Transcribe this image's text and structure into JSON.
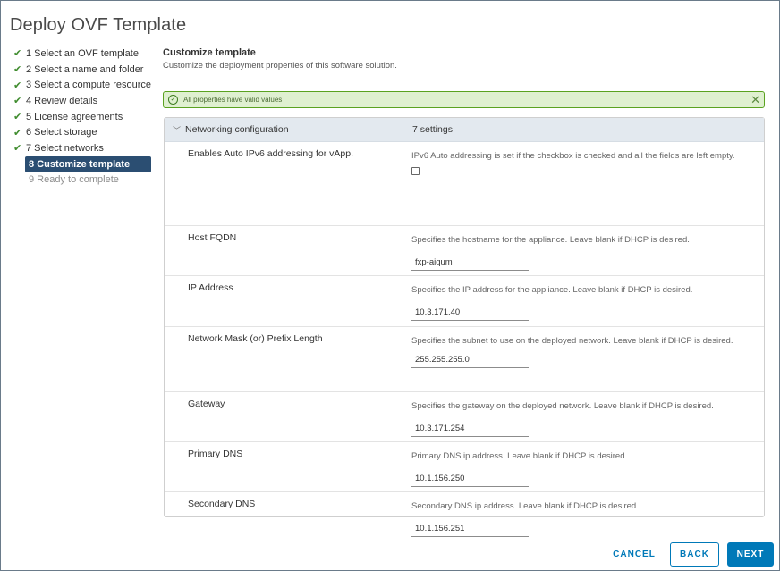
{
  "window": {
    "title": "Deploy OVF Template"
  },
  "steps": [
    {
      "label": "1 Select an OVF template",
      "state": "done"
    },
    {
      "label": "2 Select a name and folder",
      "state": "done"
    },
    {
      "label": "3 Select a compute resource",
      "state": "done"
    },
    {
      "label": "4 Review details",
      "state": "done"
    },
    {
      "label": "5 License agreements",
      "state": "done"
    },
    {
      "label": "6 Select storage",
      "state": "done"
    },
    {
      "label": "7 Select networks",
      "state": "done"
    },
    {
      "label": "8 Customize template",
      "state": "active"
    },
    {
      "label": "9 Ready to complete",
      "state": "pending"
    }
  ],
  "main": {
    "title": "Customize template",
    "subtitle": "Customize the deployment properties of this software solution."
  },
  "alert": {
    "text": "All properties have valid values",
    "color": "#5aa220"
  },
  "table": {
    "group_label": "Networking configuration",
    "group_count": "7 settings",
    "rows": [
      {
        "label": "Enables Auto IPv6 addressing for vApp.",
        "description": "IPv6 Auto addressing is set if the checkbox is checked and all the fields are left empty.",
        "type": "checkbox",
        "checked": false
      },
      {
        "label": "Host FQDN",
        "description": "Specifies the hostname for the appliance. Leave blank if DHCP is desired.",
        "type": "text",
        "value": "fxp-aiqum"
      },
      {
        "label": "IP Address",
        "description": "Specifies the IP address for the appliance. Leave blank if DHCP is desired.",
        "type": "text",
        "value": "10.3.171.40"
      },
      {
        "label": "Network Mask (or) Prefix Length",
        "description": "Specifies the subnet to use on the deployed network. Leave blank if DHCP is desired.",
        "type": "text",
        "value": "255.255.255.0"
      },
      {
        "label": "Gateway",
        "description": "Specifies the gateway on the deployed network. Leave blank if DHCP is desired.",
        "type": "text",
        "value": "10.3.171.254"
      },
      {
        "label": "Primary DNS",
        "description": "Primary DNS ip address. Leave blank if DHCP is desired.",
        "type": "text",
        "value": "10.1.156.250"
      },
      {
        "label": "Secondary DNS",
        "description": "Secondary DNS ip address. Leave blank if DHCP is desired.",
        "type": "text",
        "value": "10.1.156.251"
      }
    ]
  },
  "footer": {
    "cancel": "CANCEL",
    "back": "BACK",
    "next": "NEXT"
  },
  "colors": {
    "accent": "#0079b8",
    "active_step": "#2b4e72",
    "check": "#3f8c2e",
    "header_bg": "#e3e9ef"
  },
  "icons": {
    "step_done": "check-icon",
    "alert_ok": "check-circle-icon",
    "alert_close": "close-icon",
    "group_toggle": "chevron-down-icon"
  }
}
